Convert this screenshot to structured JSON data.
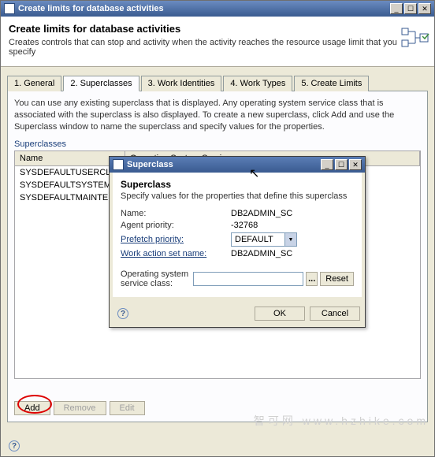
{
  "window": {
    "title": "Create limits for database activities",
    "header_title": "Create limits for database activities",
    "header_desc": "Creates controls that can stop and activity when the activity reaches the resource usage limit that you specify"
  },
  "tabs": [
    {
      "label": "1. General"
    },
    {
      "label": "2. Superclasses"
    },
    {
      "label": "3. Work Identities"
    },
    {
      "label": "4. Work Types"
    },
    {
      "label": "5. Create Limits"
    }
  ],
  "pane": {
    "desc": "You can use any existing superclass that is displayed. Any operating system service class that is associated with the superclass is also displayed. To create a new superclass, click Add and use the Superclass window to name the superclass and specify values for the properties.",
    "section_label": "Superclasses",
    "cols": {
      "name": "Name",
      "os": "Operating System Servi..."
    },
    "rows": [
      "SYSDEFAULTUSERCLASS",
      "SYSDEFAULTSYSTEMCLASS",
      "SYSDEFAULTMAINTENA..."
    ],
    "buttons": {
      "add": "Add",
      "remove": "Remove",
      "edit": "Edit"
    }
  },
  "dialog": {
    "title": "Superclass",
    "heading": "Superclass",
    "sub": "Specify values for the properties that define this superclass",
    "fields": {
      "name_label": "Name:",
      "name_value": "DB2ADMIN_SC",
      "agent_label": "Agent priority:",
      "agent_value": "-32768",
      "prefetch_label": "Prefetch priority:",
      "prefetch_value": "DEFAULT",
      "waset_label": "Work action set name:",
      "waset_value": "DB2ADMIN_SC",
      "osclass_label": "Operating system service class:"
    },
    "buttons": {
      "ok": "OK",
      "cancel": "Cancel",
      "reset": "Reset",
      "browse": "..."
    }
  },
  "watermark": "智可网 www.hzhike.com"
}
